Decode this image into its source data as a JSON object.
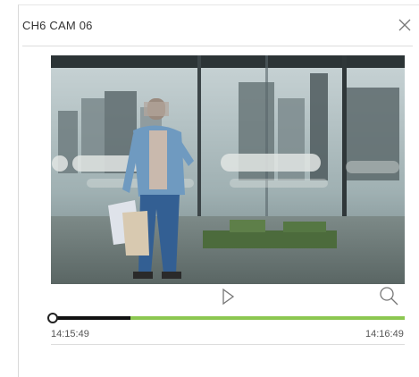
{
  "dialog": {
    "title": "CH6 CAM 06",
    "close_icon": "close-icon"
  },
  "video": {
    "content": "camera-frame",
    "person_blurred": true
  },
  "controls": {
    "play_icon": "play-icon",
    "zoom_icon": "magnifier-icon"
  },
  "timeline": {
    "start_time": "14:15:49",
    "end_time": "14:16:49",
    "played_fraction": 0.22,
    "colors": {
      "played": "#111111",
      "recorded": "#8cc751"
    }
  }
}
